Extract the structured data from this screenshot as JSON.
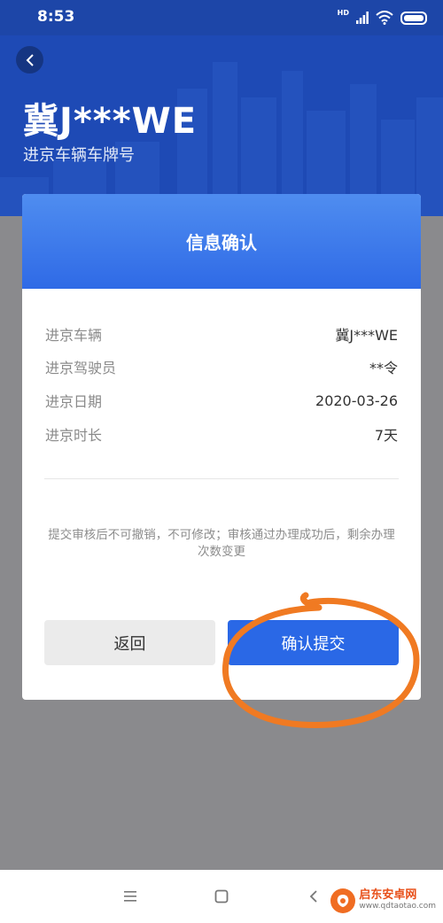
{
  "status_bar": {
    "time": "8:53",
    "network_badge": "HD"
  },
  "header": {
    "plate": "冀J***WE",
    "subtitle": "进京车辆车牌号"
  },
  "dialog": {
    "title": "信息确认",
    "rows": [
      {
        "label": "进京车辆",
        "value": "冀J***WE"
      },
      {
        "label": "进京驾驶员",
        "value": "**令"
      },
      {
        "label": "进京日期",
        "value": "2020-03-26"
      },
      {
        "label": "进京时长",
        "value": "7天"
      }
    ],
    "notice": "提交审核后不可撤销，不可修改；审核通过办理成功后，剩余办理次数变更",
    "back_label": "返回",
    "submit_label": "确认提交"
  },
  "watermark": {
    "name": "启东安卓网",
    "url": "www.qdtaotao.com"
  },
  "colors": {
    "header_blue": "#1e4ab5",
    "dialog_blue": "#2f6ae6",
    "submit_blue": "#2a68e6",
    "annotation_orange": "#f07a22"
  }
}
